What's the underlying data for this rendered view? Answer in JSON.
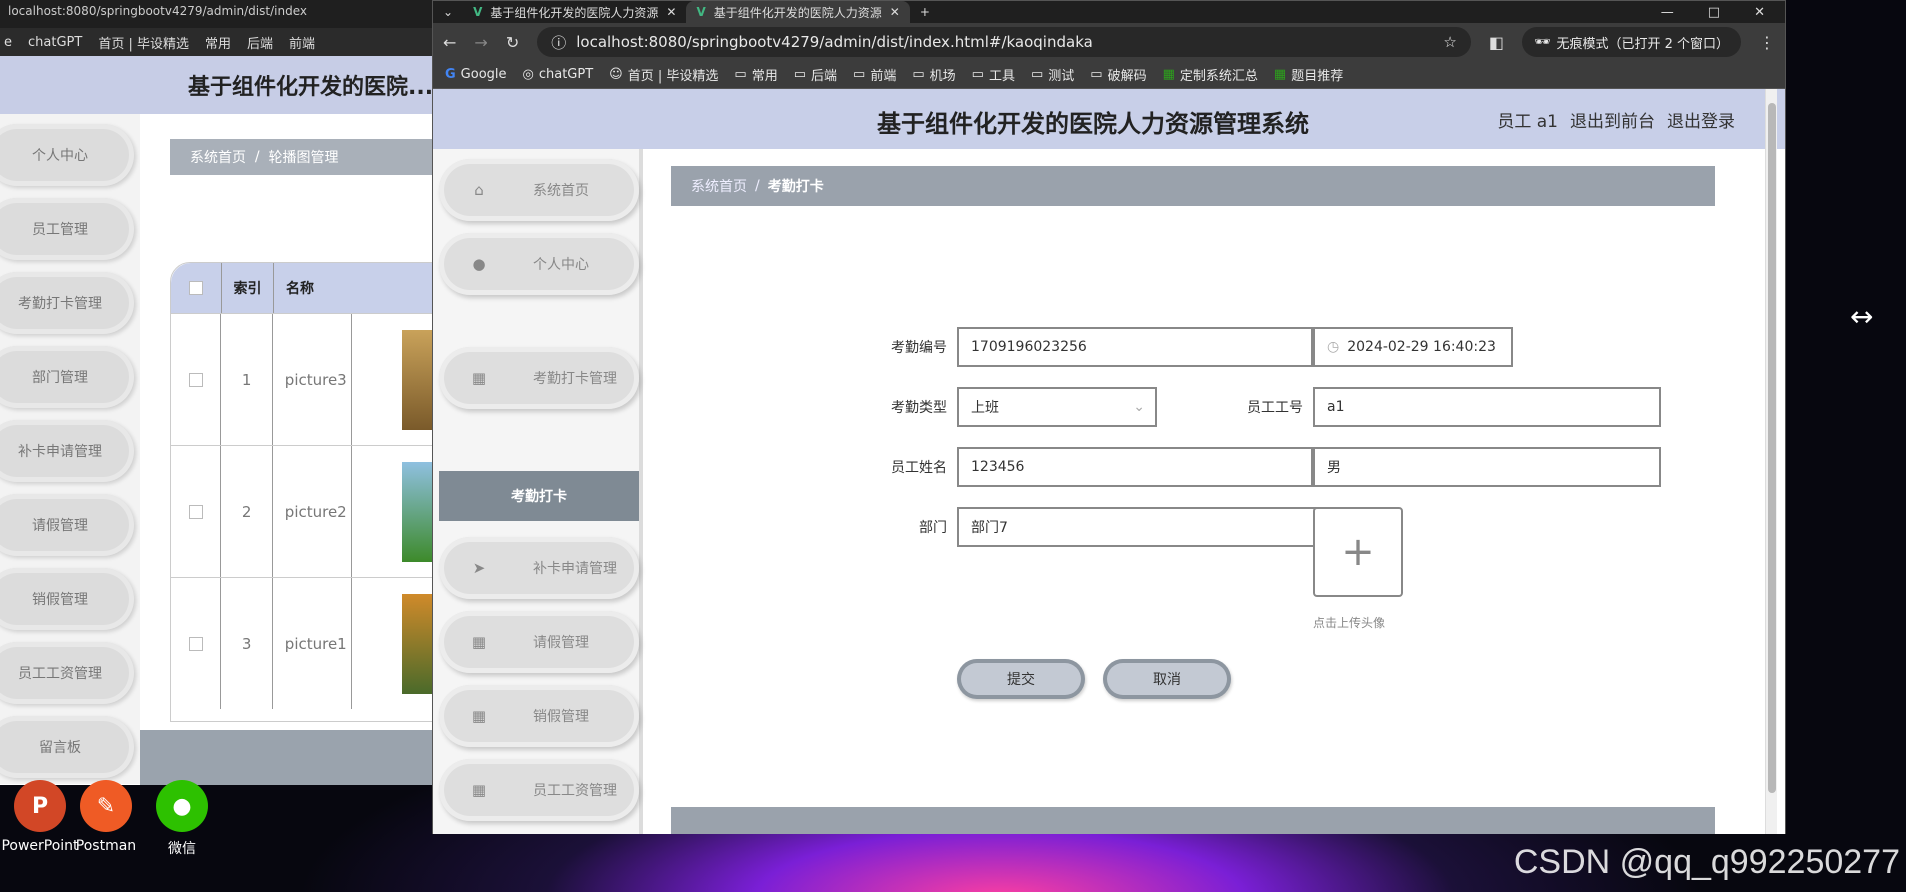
{
  "desktop": {
    "watermark": "CSDN @qq_q992250277",
    "icons": [
      {
        "label": "PowerPoint",
        "glyph": "P",
        "color": "#d24726"
      },
      {
        "label": "Postman",
        "glyph": "✎",
        "color": "#ef5b25"
      },
      {
        "label": "微信",
        "glyph": "●",
        "color": "#2dc100"
      }
    ]
  },
  "back_window": {
    "tab_text": "localhost:8080/springbootv4279/admin/dist/index",
    "bookmarks": [
      "e",
      "chatGPT",
      "首页 | 毕设精选",
      "常用",
      "后端",
      "前端"
    ],
    "title": "基于组件化开发的医院...",
    "sidebar": [
      "个人中心",
      "员工管理",
      "考勤打卡管理",
      "部门管理",
      "补卡申请管理",
      "请假管理",
      "销假管理",
      "员工工资管理",
      "留言板"
    ],
    "breadcrumb": {
      "home": "系统首页",
      "sep": "/",
      "current": "轮播图管理"
    },
    "table": {
      "headers": [
        "索引",
        "名称"
      ],
      "rows": [
        {
          "index": "1",
          "name": "picture3"
        },
        {
          "index": "2",
          "name": "picture2"
        },
        {
          "index": "3",
          "name": "picture1"
        }
      ]
    }
  },
  "browser": {
    "tabs": [
      {
        "title": "基于组件化开发的医院人力资源",
        "active": false
      },
      {
        "title": "基于组件化开发的医院人力资源",
        "active": true
      }
    ],
    "new_tab": "+",
    "url": "localhost:8080/springbootv4279/admin/dist/index.html#/kaoqindaka",
    "incognito": "无痕模式（已打开 2 个窗口）",
    "bookmarks": [
      "Google",
      "chatGPT",
      "首页 | 毕设精选",
      "常用",
      "后端",
      "前端",
      "机场",
      "工具",
      "测试",
      "破解码",
      "定制系统汇总",
      "题目推荐"
    ]
  },
  "app": {
    "title": "基于组件化开发的医院人力资源管理系统",
    "user": "员工 a1",
    "to_front": "退出到前台",
    "logout": "退出登录",
    "sidebar": [
      {
        "label": "系统首页",
        "icon": "home-icon"
      },
      {
        "label": "个人中心",
        "icon": "user-icon"
      },
      {
        "label": "考勤打卡管理",
        "icon": "grid-icon"
      },
      {
        "label": "补卡申请管理",
        "icon": "send-icon"
      },
      {
        "label": "请假管理",
        "icon": "grid-icon"
      },
      {
        "label": "销假管理",
        "icon": "grid-icon"
      },
      {
        "label": "员工工资管理",
        "icon": "grid-icon"
      }
    ],
    "sidebar_sub_active": "考勤打卡",
    "breadcrumb": {
      "home": "系统首页",
      "sep": "/",
      "current": "考勤打卡"
    },
    "form": {
      "kaoqin_no_label": "考勤编号",
      "kaoqin_no": "1709196023256",
      "datetime": "2024-02-29 16:40:23",
      "type_label": "考勤类型",
      "type_value": "上班",
      "emp_no_label": "员工工号",
      "emp_no": "a1",
      "emp_name_label": "员工姓名",
      "emp_name": "123456",
      "gender": "男",
      "dept_label": "部门",
      "dept": "部门7",
      "upload_hint": "点击上传头像",
      "submit": "提交",
      "cancel": "取消"
    }
  }
}
